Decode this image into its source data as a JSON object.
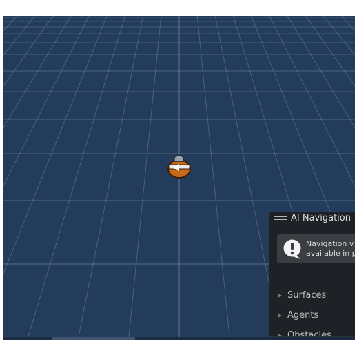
{
  "scene_view": {
    "background": "#243c5c",
    "grid_color": "#8fa8c4"
  },
  "gizmo": {
    "icon": "audio-source-icon",
    "body_color": "#c86a1e"
  },
  "ai_navigation_panel": {
    "title": "AI Navigation",
    "message_line1": "Navigation v",
    "message_line2": "available in p",
    "message_icon": "warning-icon",
    "sections": [
      {
        "label": "Surfaces"
      },
      {
        "label": "Agents"
      },
      {
        "label": "Obstacles"
      }
    ]
  }
}
